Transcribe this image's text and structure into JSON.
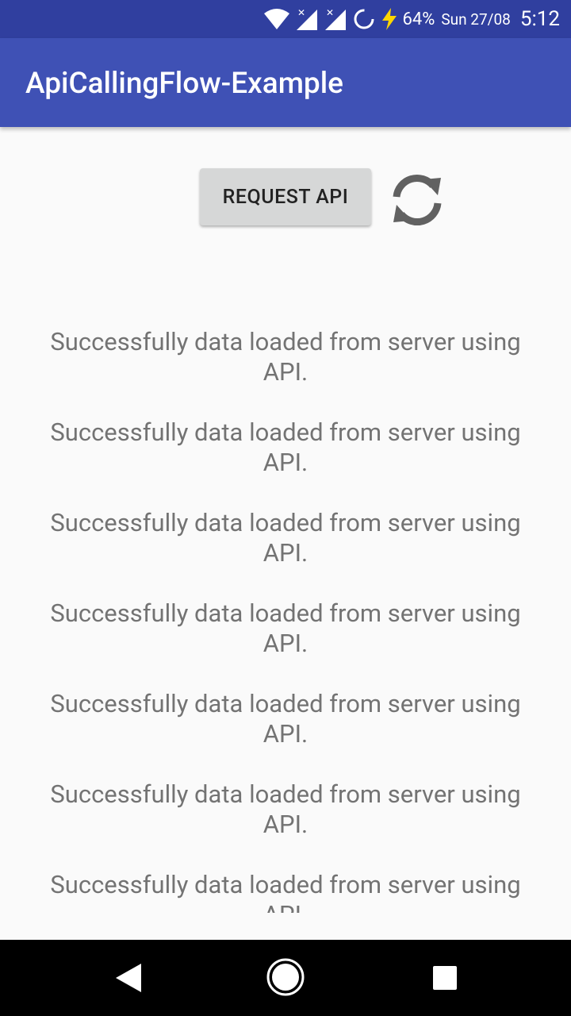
{
  "status_bar": {
    "battery": "64%",
    "date": "Sun 27/08",
    "time": "5:12",
    "icons": [
      "wifi-icon",
      "signal-x-icon",
      "signal-x-icon",
      "sync-circle-icon",
      "charging-bolt-icon"
    ]
  },
  "app_bar": {
    "title": "ApiCallingFlow-Example"
  },
  "controls": {
    "request_label": "REQUEST API",
    "refresh_icon": "refresh-icon"
  },
  "messages": [
    "Successfully data loaded from server using API.",
    "Successfully data loaded from server using API.",
    "Successfully data loaded from server using API.",
    "Successfully data loaded from server using API.",
    "Successfully data loaded from server using API.",
    "Successfully data loaded from server using API.",
    "Successfully data loaded from server using API."
  ],
  "nav_bar": {
    "icons": [
      "back-icon",
      "home-icon",
      "recents-icon"
    ]
  },
  "colors": {
    "status_bar": "#303f9f",
    "app_bar": "#3f51b5",
    "button": "#d6d7d7",
    "text": "#737373"
  }
}
